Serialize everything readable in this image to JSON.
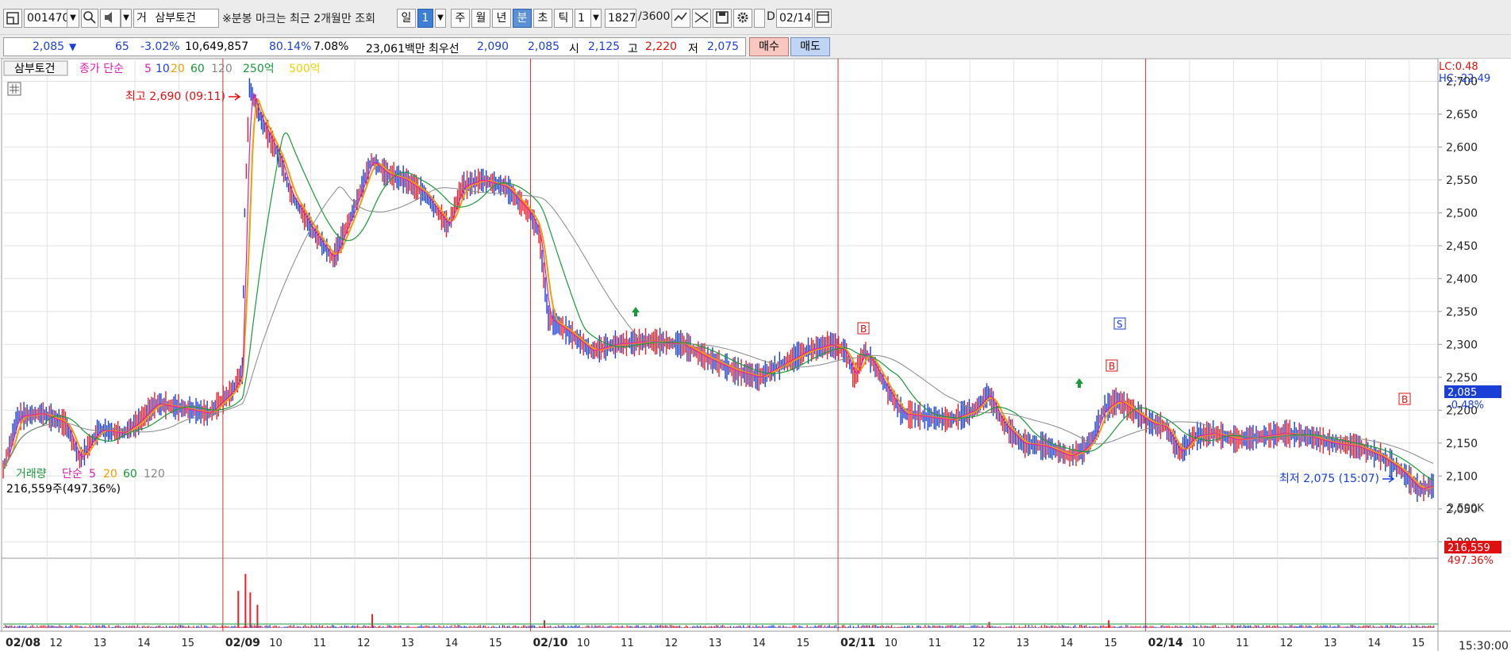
{
  "toolbar": {
    "code": "001470",
    "market_tag": "거",
    "stock_name": "삼부토건",
    "notice": "※분봉 마크는 최근 2개월만 조회",
    "periods": [
      "일",
      "1",
      "주",
      "월",
      "년",
      "분",
      "초",
      "틱"
    ],
    "interval": "1",
    "count": "1827",
    "count_max": "/3600",
    "date_prefix": "D",
    "date": "02/14"
  },
  "info": {
    "price": "2,085",
    "change": "65",
    "change_pct": "-3.02%",
    "volume": "10,649,857",
    "vol_ratio": "80.14%",
    "turnover": "7.08%",
    "amount": "23,061백만",
    "best_label": "최우선",
    "best_ask": "2,090",
    "best_bid": "2,085",
    "open_label": "시",
    "open": "2,125",
    "high_label": "고",
    "high": "2,220",
    "low_label": "저",
    "low": "2,075",
    "buy": "매수",
    "sell": "매도"
  },
  "legend": {
    "name": "삼부토건",
    "price_label": "종가 단순",
    "ma": [
      "5",
      "10",
      "20",
      "60",
      "120"
    ],
    "extra1": "250억",
    "extra2": "500억",
    "lc": "LC:0.48",
    "hc": "HC:-22.49"
  },
  "annotations": {
    "high_label": "최고 2,690 (09:11)",
    "low_label": "최저 2,075 (15:07)",
    "current_price": "2,085",
    "current_pct": "-0.48%"
  },
  "volume_panel": {
    "title": "거래량",
    "ma_label": "단순",
    "ma": [
      "5",
      "20",
      "60",
      "120"
    ],
    "value": "216,559주(497.36%)",
    "axis_label": "2,500K",
    "current_volume": "216,559",
    "current_pct": "497.36%"
  },
  "time_axis": {
    "labels": [
      "02/08",
      "12",
      "13",
      "14",
      "15",
      "02/09",
      "10",
      "11",
      "12",
      "13",
      "14",
      "15",
      "02/10",
      "10",
      "11",
      "12",
      "13",
      "14",
      "15",
      "02/11",
      "10",
      "11",
      "12",
      "13",
      "14",
      "15",
      "02/14",
      "10",
      "11",
      "12",
      "13",
      "14",
      "15"
    ],
    "last_time": "15:30:00"
  },
  "colors": {
    "up": "#e8202a",
    "down": "#1a3fd6",
    "ma5": "#e01cb4",
    "ma10": "#1a3fd6",
    "ma20": "#f0a000",
    "ma60": "#1a9a3a",
    "ma120": "#888888",
    "day_separator": "#e03030"
  },
  "chart_data": {
    "type": "line",
    "title": "삼부토건 분봉",
    "y_ticks": [
      2000,
      2050,
      2100,
      2150,
      2200,
      2250,
      2300,
      2350,
      2400,
      2450,
      2500,
      2550,
      2600,
      2650,
      2700
    ],
    "ylim": [
      1975,
      2715
    ],
    "days": [
      "02/08",
      "02/09",
      "02/10",
      "02/11",
      "02/14"
    ],
    "series": [
      {
        "name": "종가",
        "points": [
          [
            0,
            2110
          ],
          [
            0.3,
            2190
          ],
          [
            0.8,
            2195
          ],
          [
            1.3,
            2180
          ],
          [
            1.6,
            2125
          ],
          [
            2.0,
            2170
          ],
          [
            2.5,
            2165
          ],
          [
            2.8,
            2180
          ],
          [
            3.2,
            2210
          ],
          [
            3.6,
            2205
          ],
          [
            4.3,
            2195
          ],
          [
            4.8,
            2230
          ],
          [
            5.0,
            2260
          ],
          [
            5.05,
            2500
          ],
          [
            5.15,
            2690
          ],
          [
            5.4,
            2640
          ],
          [
            5.8,
            2580
          ],
          [
            6.0,
            2530
          ],
          [
            6.5,
            2470
          ],
          [
            6.9,
            2430
          ],
          [
            7.3,
            2500
          ],
          [
            7.7,
            2580
          ],
          [
            8.0,
            2560
          ],
          [
            8.4,
            2550
          ],
          [
            8.8,
            2530
          ],
          [
            9.3,
            2480
          ],
          [
            9.6,
            2540
          ],
          [
            10.0,
            2550
          ],
          [
            10.5,
            2540
          ],
          [
            11.0,
            2500
          ],
          [
            11.2,
            2470
          ],
          [
            11.4,
            2340
          ],
          [
            11.8,
            2320
          ],
          [
            12.3,
            2290
          ],
          [
            12.8,
            2300
          ],
          [
            13.5,
            2305
          ],
          [
            14.2,
            2300
          ],
          [
            14.7,
            2280
          ],
          [
            15.3,
            2260
          ],
          [
            15.8,
            2250
          ],
          [
            16.3,
            2270
          ],
          [
            16.8,
            2290
          ],
          [
            17.3,
            2300
          ],
          [
            17.6,
            2290
          ],
          [
            17.8,
            2250
          ],
          [
            18.0,
            2290
          ],
          [
            18.2,
            2270
          ],
          [
            18.5,
            2230
          ],
          [
            18.8,
            2195
          ],
          [
            19.3,
            2190
          ],
          [
            19.8,
            2185
          ],
          [
            20.3,
            2200
          ],
          [
            20.6,
            2225
          ],
          [
            20.9,
            2180
          ],
          [
            21.3,
            2150
          ],
          [
            21.8,
            2145
          ],
          [
            22.3,
            2130
          ],
          [
            22.6,
            2140
          ],
          [
            22.8,
            2160
          ],
          [
            23.0,
            2200
          ],
          [
            23.3,
            2215
          ],
          [
            23.6,
            2200
          ],
          [
            24.0,
            2180
          ],
          [
            24.3,
            2175
          ],
          [
            24.6,
            2135
          ],
          [
            24.9,
            2160
          ],
          [
            25.3,
            2165
          ],
          [
            25.8,
            2155
          ],
          [
            26.3,
            2160
          ],
          [
            26.8,
            2165
          ],
          [
            27.3,
            2160
          ],
          [
            27.8,
            2150
          ],
          [
            28.3,
            2145
          ],
          [
            28.8,
            2130
          ],
          [
            29.2,
            2110
          ],
          [
            29.6,
            2080
          ],
          [
            29.9,
            2085
          ]
        ]
      }
    ],
    "volume": {
      "ylim": [
        0,
        4000000
      ],
      "spikes": [
        [
          5.05,
          3500000
        ],
        [
          5.15,
          2300000
        ],
        [
          4.9,
          2400000
        ],
        [
          5.3,
          1500000
        ],
        [
          7.7,
          900000
        ],
        [
          11.3,
          500000
        ],
        [
          20.6,
          400000
        ],
        [
          23.1,
          500000
        ]
      ]
    }
  }
}
